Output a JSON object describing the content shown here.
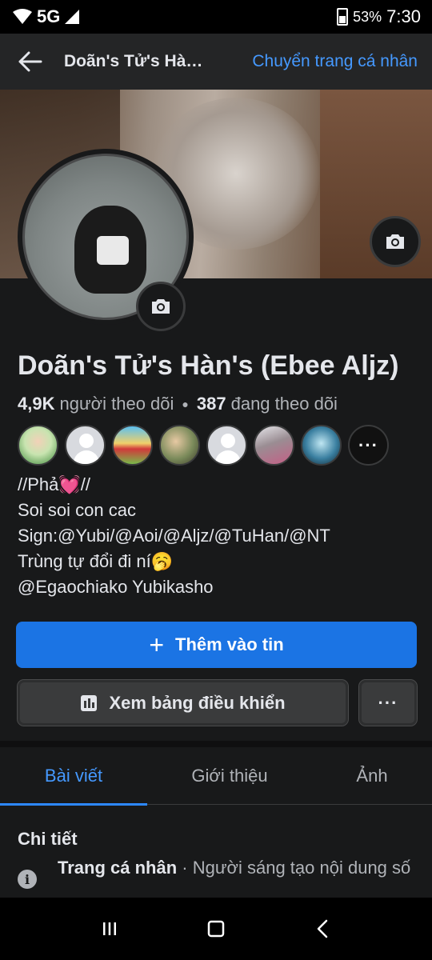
{
  "status_bar": {
    "network": "5G",
    "battery": "53%",
    "time": "7:30"
  },
  "app_bar": {
    "title": "Doãn's Tử's Hàn's (Ebee Aljz)",
    "switch_label": "Chuyển trang cá nhân"
  },
  "profile": {
    "name": "Doãn's Tử's Hàn's (Ebee Aljz)",
    "followers_count": "4,9K",
    "followers_label": "người theo dõi",
    "following_count": "387",
    "following_label": "đang theo dõi"
  },
  "followers_preview": {
    "more_label": "···"
  },
  "bio": {
    "line1": "//Phả💓//",
    "line2": "Soi soi con cac",
    "line3": "Sign:@Yubi/@Aoi/@Aljz/@TuHan/@NT",
    "line4": "Trùng tự đổi đi ní🥱",
    "line5": "@Egaochiako Yubikasho"
  },
  "buttons": {
    "add_story": "Thêm vào tin",
    "dashboard": "Xem bảng điều khiển",
    "more": "···"
  },
  "tabs": [
    {
      "label": "Bài viết",
      "active": true
    },
    {
      "label": "Giới thiệu",
      "active": false
    },
    {
      "label": "Ảnh",
      "active": false
    }
  ],
  "details": {
    "title": "Chi tiết",
    "item_label": "Trang cá nhân",
    "item_value": " · Người sáng tạo nội dung số"
  },
  "colors": {
    "accent": "#1b74e4",
    "link": "#4599ff",
    "background": "#18191a"
  }
}
